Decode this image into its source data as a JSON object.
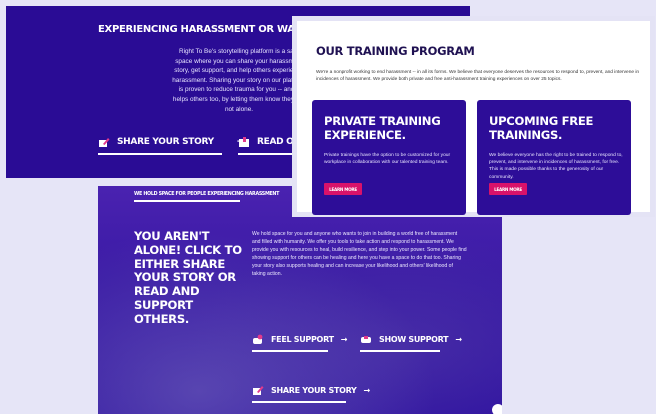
{
  "top_panel": {
    "title": "EXPERIENCING HARASSMENT OR WANT TO SUPPORT",
    "body": "Right To Be's storytelling platform is a safe space where you can share your harassment story, get support, and help others experience harassment. Sharing your story on our platform is proven to reduce trauma for you -- and it helps others too, by letting them know they are not alone.",
    "share_label": "SHARE YOUR STORY",
    "read_label": "READ OT"
  },
  "training": {
    "heading": "OUR TRAINING PROGRAM",
    "intro": "We're a nonprofit working to end harassment -- in all its forms. We believe that everyone deserves the resources to respond to, prevent, and intervene in incidences of harassment. We provide both private and free anti-harassment training experiences on over 25 topics.",
    "cards": [
      {
        "title": "PRIVATE TRAINING EXPERIENCE.",
        "desc": "Private trainings have the option to be customized for your workplace in collaboration with our talented training team.",
        "button": "LEARN MORE"
      },
      {
        "title": "UPCOMING FREE TRAININGS.",
        "desc": "We believe everyone has the right to be trained to respond to, prevent, and intervene in incidences of harassment, for free. This is made possible thanks to the generosity of our community.",
        "button": "LEARN MORE"
      }
    ]
  },
  "support_panel": {
    "tag": "WE HOLD SPACE FOR PEOPLE EXPERIENCING HARASSMENT",
    "heading": "YOU AREN'T ALONE! CLICK TO EITHER SHARE YOUR STORY OR READ AND SUPPORT OTHERS.",
    "body": "We hold space for you and anyone who wants to join in building a world free of harassment and filled with humanity. We offer you tools to take action and respond to harassment. We provide you with resources to heal, build resilience, and step into your power. Some people find showing support for others can be healing and here you have a space to do that too. Sharing your story also supports healing and can increase your likelihood and others' likelihood of taking action.",
    "feel_label": "FEEL SUPPORT",
    "show_label": "SHOW SUPPORT",
    "share_label": "SHARE YOUR STORY"
  },
  "arrow": "→"
}
